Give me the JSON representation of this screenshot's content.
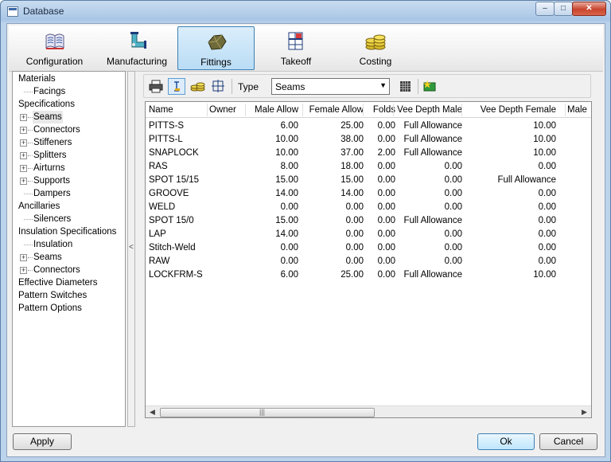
{
  "window": {
    "title": "Database",
    "min_glyph": "–",
    "max_glyph": "□",
    "close_glyph": "✕"
  },
  "toolbar": {
    "items": [
      {
        "label": "Configuration",
        "icon": "book-icon"
      },
      {
        "label": "Manufacturing",
        "icon": "duct-elbow-icon"
      },
      {
        "label": "Fittings",
        "icon": "fitting-stone-icon",
        "active": true
      },
      {
        "label": "Takeoff",
        "icon": "takeoff-grid-icon"
      },
      {
        "label": "Costing",
        "icon": "coins-icon"
      }
    ]
  },
  "tree": {
    "items": [
      {
        "label": "Materials",
        "level": 0,
        "expander": false
      },
      {
        "label": "Facings",
        "level": 1,
        "expander": false
      },
      {
        "label": "Specifications",
        "level": 0,
        "expander": false
      },
      {
        "label": "Seams",
        "level": 1,
        "expander": true,
        "selected": true
      },
      {
        "label": "Connectors",
        "level": 1,
        "expander": true
      },
      {
        "label": "Stiffeners",
        "level": 1,
        "expander": true
      },
      {
        "label": "Splitters",
        "level": 1,
        "expander": true
      },
      {
        "label": "Airturns",
        "level": 1,
        "expander": true
      },
      {
        "label": "Supports",
        "level": 1,
        "expander": true
      },
      {
        "label": "Dampers",
        "level": 1,
        "expander": false
      },
      {
        "label": "Ancillaries",
        "level": 0,
        "expander": false
      },
      {
        "label": "Silencers",
        "level": 1,
        "expander": false
      },
      {
        "label": "Insulation Specifications",
        "level": 0,
        "expander": false
      },
      {
        "label": "Insulation",
        "level": 1,
        "expander": false
      },
      {
        "label": "Seams",
        "level": 1,
        "expander": true
      },
      {
        "label": "Connectors",
        "level": 1,
        "expander": true
      },
      {
        "label": "Effective Diameters",
        "level": 0,
        "expander": false
      },
      {
        "label": "Pattern Switches",
        "level": 0,
        "expander": false
      },
      {
        "label": "Pattern Options",
        "level": 0,
        "expander": false
      }
    ]
  },
  "splitter": {
    "arrow": "<"
  },
  "grid_toolbar": {
    "type_label": "Type",
    "type_value": "Seams",
    "select_arrow": "▼"
  },
  "table": {
    "columns": [
      "Name",
      "Owner",
      "Male Allow",
      "Female Allow",
      "Folds",
      "Vee Depth Male",
      "Vee Depth Female",
      "Male"
    ],
    "rows": [
      [
        "PITTS-S",
        "",
        "6.00",
        "25.00",
        "0.00",
        "Full Allowance",
        "10.00"
      ],
      [
        "PITTS-L",
        "",
        "10.00",
        "38.00",
        "0.00",
        "Full Allowance",
        "10.00"
      ],
      [
        "SNAPLOCK",
        "",
        "10.00",
        "37.00",
        "2.00",
        "Full Allowance",
        "10.00"
      ],
      [
        "RAS",
        "",
        "8.00",
        "18.00",
        "0.00",
        "0.00",
        "0.00"
      ],
      [
        "SPOT 15/15",
        "",
        "15.00",
        "15.00",
        "0.00",
        "0.00",
        "Full Allowance"
      ],
      [
        "GROOVE",
        "",
        "14.00",
        "14.00",
        "0.00",
        "0.00",
        "0.00"
      ],
      [
        "WELD",
        "",
        "0.00",
        "0.00",
        "0.00",
        "0.00",
        "0.00"
      ],
      [
        "SPOT 15/0",
        "",
        "15.00",
        "0.00",
        "0.00",
        "Full Allowance",
        "0.00"
      ],
      [
        "LAP",
        "",
        "14.00",
        "0.00",
        "0.00",
        "0.00",
        "0.00"
      ],
      [
        "Stitch-Weld",
        "",
        "0.00",
        "0.00",
        "0.00",
        "0.00",
        "0.00"
      ],
      [
        "RAW",
        "",
        "0.00",
        "0.00",
        "0.00",
        "0.00",
        "0.00"
      ],
      [
        "LOCKFRM-S",
        "",
        "6.00",
        "25.00",
        "0.00",
        "Full Allowance",
        "10.00"
      ]
    ],
    "scroll_left": "◀",
    "scroll_right": "▶",
    "scroll_grip": "|||"
  },
  "buttons": {
    "apply": "Apply",
    "ok": "Ok",
    "cancel": "Cancel"
  }
}
